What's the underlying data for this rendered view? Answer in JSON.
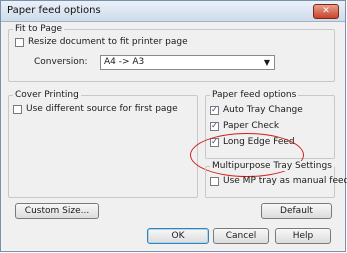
{
  "window": {
    "title": "Paper feed options",
    "close_label": "✕"
  },
  "fit_to_page": {
    "group_label": "Fit to Page",
    "resize_label": "Resize document to fit printer page",
    "conversion_label": "Conversion:",
    "conversion_value": "A4 -> A3"
  },
  "cover_printing": {
    "group_label": "Cover Printing",
    "use_diff_label": "Use different source for first page"
  },
  "paper_feed": {
    "group_label": "Paper feed options",
    "auto_tray_label": "Auto Tray Change",
    "paper_check_label": "Paper Check",
    "long_edge_label": "Long Edge Feed"
  },
  "mp_tray": {
    "group_label": "Multipurpose Tray Settings",
    "use_mp_label": "Use MP tray as manual feed"
  },
  "buttons": {
    "custom_size": "Custom Size...",
    "default": "Default",
    "ok": "OK",
    "cancel": "Cancel",
    "help": "Help"
  },
  "highlight_color": "#d21e1e"
}
